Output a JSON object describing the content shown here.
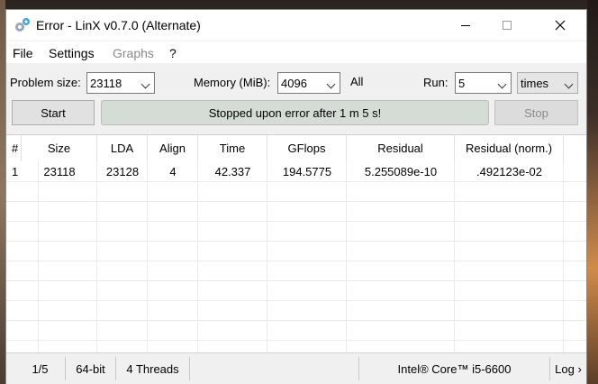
{
  "window": {
    "title": "Error - LinX v0.7.0 (Alternate)"
  },
  "menu": [
    "File",
    "Settings",
    "Graphs",
    "?"
  ],
  "controls": {
    "problem_size_label": "Problem size:",
    "problem_size_value": "23118",
    "memory_label": "Memory (MiB):",
    "memory_value": "4096",
    "memory_all": "All",
    "run_label": "Run:",
    "run_value": "5",
    "run_unit": "times",
    "start_label": "Start",
    "status_message": "Stopped upon error after 1 m 5 s!",
    "stop_label": "Stop"
  },
  "table": {
    "headers": [
      "#",
      "Size",
      "LDA",
      "Align",
      "Time",
      "GFlops",
      "Residual",
      "Residual (norm.)"
    ],
    "rows": [
      [
        "1",
        "23118",
        "23128",
        "4",
        "42.337",
        "194.5775",
        "5.255089e-10",
        ".492123e-02"
      ]
    ]
  },
  "statusbar": {
    "progress": "1/5",
    "arch": "64-bit",
    "threads": "4 Threads",
    "cpu": "Intel® Core™ i5-6600",
    "log": "Log ›"
  }
}
